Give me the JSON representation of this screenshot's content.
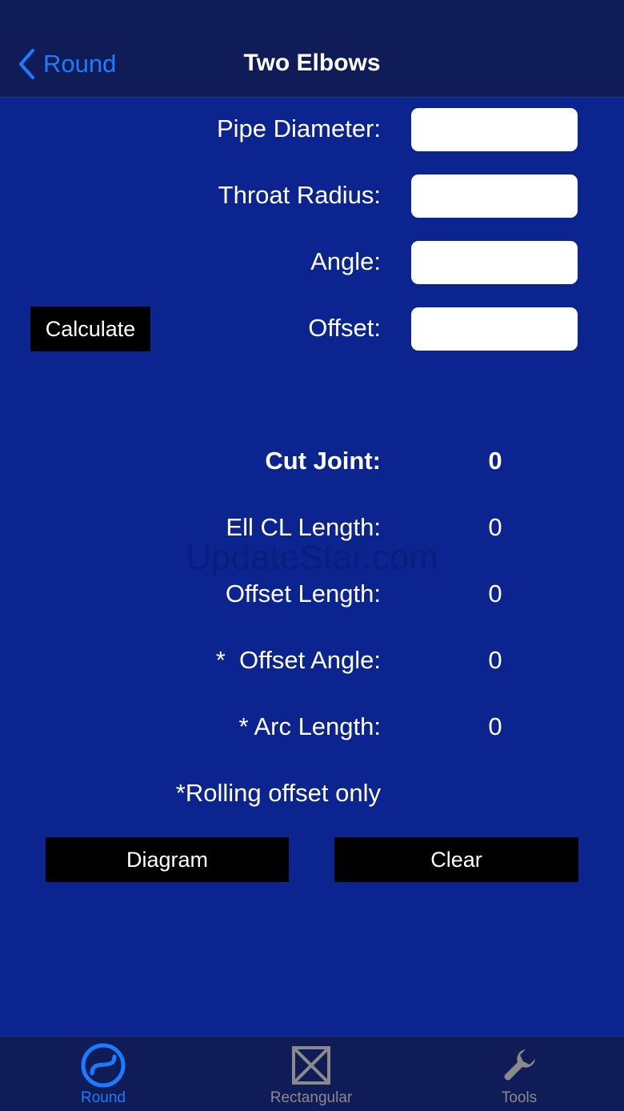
{
  "nav": {
    "back_label": "Round",
    "title": "Two Elbows"
  },
  "inputs": {
    "pipe_diameter": {
      "label": "Pipe Diameter:",
      "value": ""
    },
    "throat_radius": {
      "label": "Throat Radius:",
      "value": ""
    },
    "angle": {
      "label": "Angle:",
      "value": ""
    },
    "offset": {
      "label": "Offset:",
      "value": ""
    }
  },
  "buttons": {
    "calculate": "Calculate",
    "diagram": "Diagram",
    "clear": "Clear"
  },
  "results": {
    "cut_joint": {
      "label": "Cut Joint:",
      "value": "0"
    },
    "ell_cl_length": {
      "label": "Ell CL Length:",
      "value": "0"
    },
    "offset_length": {
      "label": "Offset Length:",
      "value": "0"
    },
    "offset_angle": {
      "label": "*  Offset Angle:",
      "value": "0"
    },
    "arc_length": {
      "label": "* Arc Length:",
      "value": "0"
    }
  },
  "footnote": "*Rolling offset only",
  "watermark": "UpdateStar.com",
  "tabs": [
    {
      "label": "Round",
      "icon": "round-icon",
      "active": true
    },
    {
      "label": "Rectangular",
      "icon": "rectangular-icon",
      "active": false
    },
    {
      "label": "Tools",
      "icon": "wrench-icon",
      "active": false
    }
  ],
  "colors": {
    "background": "#0b2490",
    "bars": "#101c58",
    "accent": "#1a7cff",
    "inactive": "#8a8a8a"
  }
}
